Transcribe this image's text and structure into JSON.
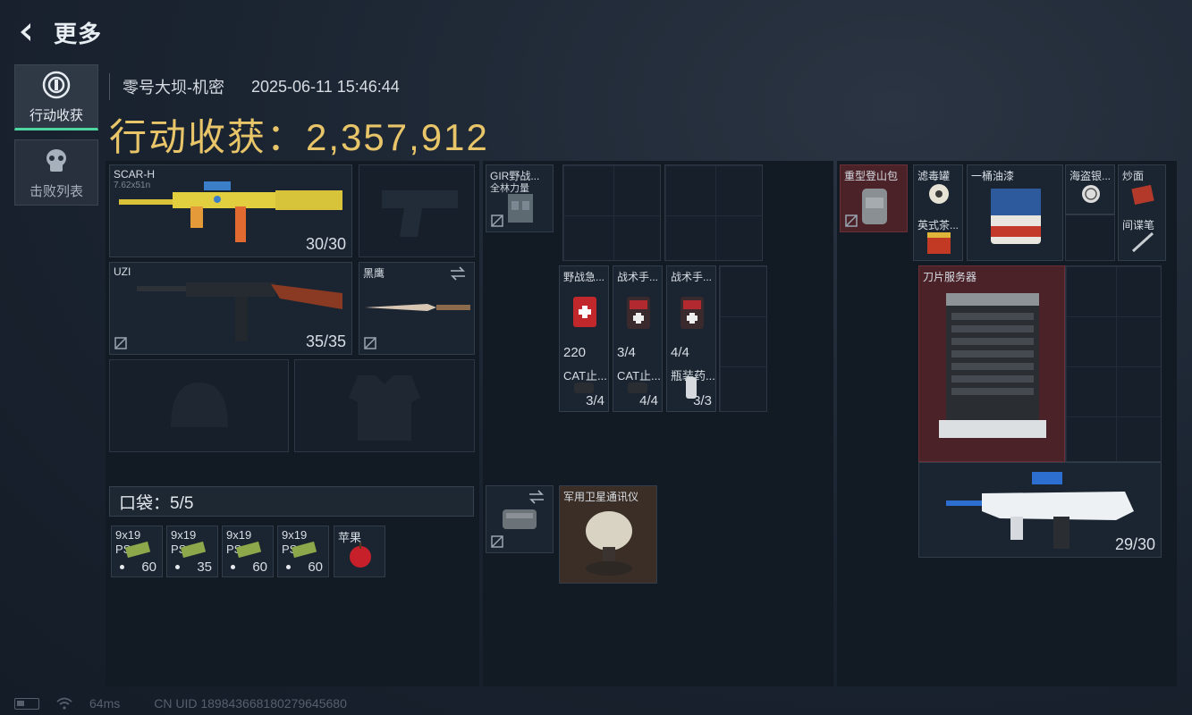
{
  "topbar": {
    "title": "更多",
    "back_icon": "chevron-left-icon"
  },
  "side_tabs": [
    {
      "label": "行动收获",
      "icon": "target-icon",
      "active": true
    },
    {
      "label": "击败列表",
      "icon": "skull-icon",
      "active": false
    }
  ],
  "header": {
    "map": "零号大坝-机密",
    "datetime": "2025-06-11 15:46:44"
  },
  "big_title": "行动收获：2,357,912",
  "loadout": {
    "primary": {
      "name": "SCAR-H",
      "sub": "7.62x51n",
      "count": "30/30"
    },
    "secondary": {
      "name": "UZI",
      "count": "35/35"
    },
    "melee": {
      "name": "黑鹰"
    }
  },
  "pocket": {
    "label": "口袋：5/5",
    "items": [
      {
        "name": "9x19",
        "name2": "PSO",
        "count": "60"
      },
      {
        "name": "9x19",
        "name2": "PSO",
        "count": "35"
      },
      {
        "name": "9x19",
        "name2": "PSO",
        "count": "60"
      },
      {
        "name": "9x19",
        "name2": "PSO",
        "count": "60"
      },
      {
        "name": "苹果",
        "name2": "",
        "count": ""
      }
    ]
  },
  "chest_rig": {
    "vest_name": "GIR野战...",
    "vest_sub": "全林力量",
    "items": [
      {
        "name": "野战急...",
        "count": "220"
      },
      {
        "name": "战术手...",
        "count": "3/4"
      },
      {
        "name": "战术手...",
        "count": "4/4"
      },
      {
        "name": "CAT止...",
        "count": "3/4"
      },
      {
        "name": "CAT止...",
        "count": "4/4"
      },
      {
        "name": "瓶装药...",
        "count": "3/3"
      }
    ],
    "satcom": "军用卫星通讯仪"
  },
  "backpack": {
    "bag_name": "重型登山包",
    "items": [
      {
        "name": "滤毒罐"
      },
      {
        "name": "英式茶..."
      },
      {
        "name": "一桶油漆"
      },
      {
        "name": "海盗银..."
      },
      {
        "name": "炒面"
      },
      {
        "name": "间谍笔"
      }
    ],
    "server": "刀片服务器",
    "rifle_count": "29/30"
  },
  "status": {
    "ping": "64ms",
    "uid": "CN UID 1898436681802796456​80"
  },
  "colors": {
    "gold": "#e9c56a",
    "accent": "#4ed6a0",
    "red_slot": "#4a2228"
  }
}
